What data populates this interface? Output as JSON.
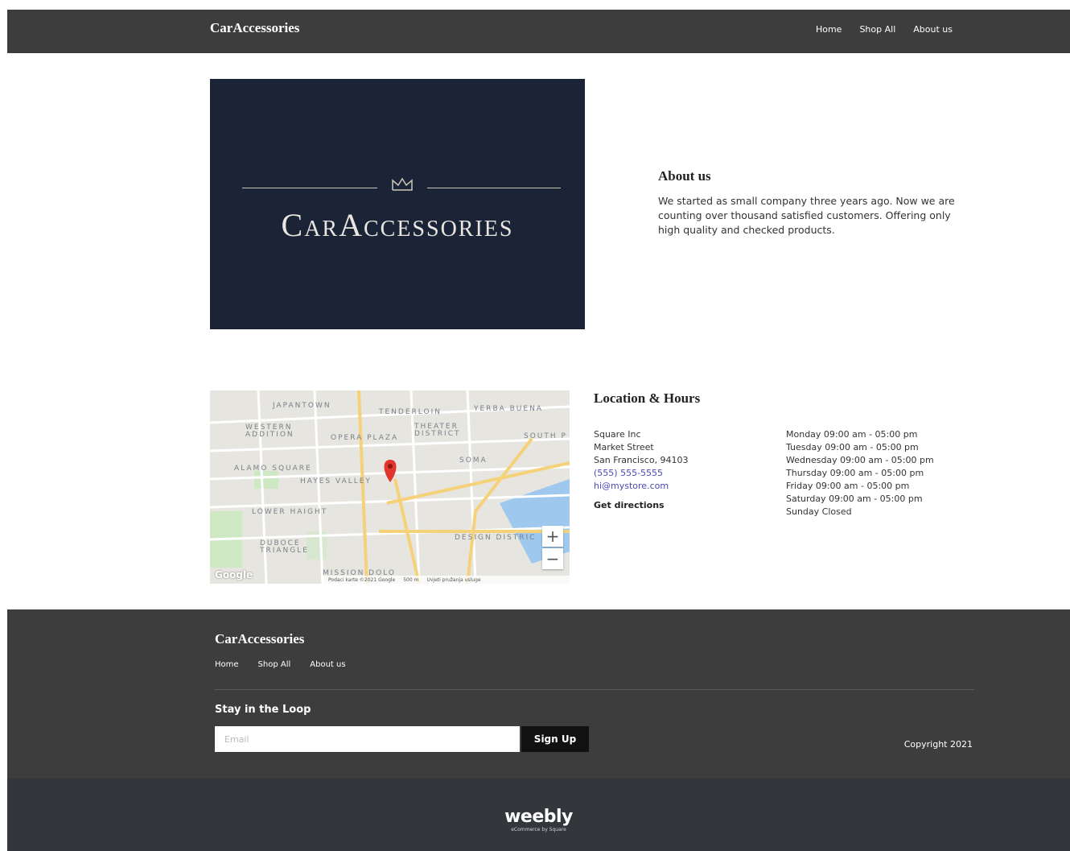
{
  "header": {
    "brand": "CarAccessories",
    "nav": [
      "Home",
      "Shop All",
      "About us"
    ]
  },
  "hero": {
    "wordmark": "CarAccessories",
    "icon": "crown-icon"
  },
  "about": {
    "title": "About us",
    "text": "We started as small company three years ago. Now we are counting over thousand satisfied customers. Offering only high quality and checked products."
  },
  "map": {
    "labels": [
      "JAPANTOWN",
      "TENDERLOIN",
      "YERBA BUENA",
      "WESTERN ADDITION",
      "OPERA PLAZA",
      "THEATER DISTRICT",
      "SOUTH P",
      "SOMA",
      "ALAMO SQUARE",
      "HAYES VALLEY",
      "LOWER HAIGHT",
      "DESIGN DISTRIC",
      "DUBOCE TRIANGLE",
      "MISSION DOLO"
    ],
    "zoom_in": "+",
    "zoom_out": "−",
    "google": "Google",
    "footer": [
      "Podaci karte ©2021 Google",
      "500 m",
      "Uvjeti pružanja usluge"
    ]
  },
  "location": {
    "title": "Location & Hours",
    "address": [
      "Square Inc",
      "Market Street",
      "San Francisco, 94103"
    ],
    "phone": "(555) 555-5555",
    "email": "hi@mystore.com",
    "directions": "Get directions",
    "hours": [
      "Monday 09:00 am - 05:00 pm",
      "Tuesday 09:00 am - 05:00 pm",
      "Wednesday 09:00 am - 05:00 pm",
      "Thursday 09:00 am - 05:00 pm",
      "Friday 09:00 am - 05:00 pm",
      "Saturday 09:00 am - 05:00 pm",
      "Sunday Closed"
    ]
  },
  "footer": {
    "brand": "CarAccessories",
    "nav": [
      "Home",
      "Shop All",
      "About us"
    ],
    "loop_title": "Stay in the Loop",
    "email_placeholder": "Email",
    "signup": "Sign Up",
    "copyright": "Copyright 2021"
  },
  "powered": {
    "name": "weebly",
    "sub": "eCommerce by Square"
  }
}
